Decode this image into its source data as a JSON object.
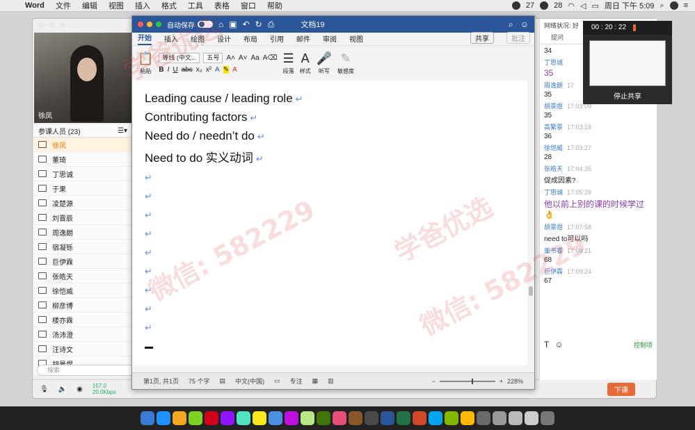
{
  "menubar": {
    "app": "Word",
    "items": [
      "文件",
      "编辑",
      "视图",
      "插入",
      "格式",
      "工具",
      "表格",
      "窗口",
      "帮助"
    ],
    "wechat_count": "27",
    "badge_count": "28",
    "clock": "周日 下午 5:09"
  },
  "classroom": {
    "teacher_name": "徐凤",
    "participants_header": "参课人员 (23)",
    "participants": [
      "徐凤",
      "董琦",
      "丁思诚",
      "于果",
      "凌楚源",
      "刘晋辰",
      "周逸朗",
      "宿凝铄",
      "巨伊霖",
      "张皓天",
      "徐恺威",
      "柳彦博",
      "楼亦霖",
      "汤沛澄",
      "汪诗文",
      "胡景煜"
    ],
    "search_placeholder": "搜索",
    "net_stat": "157.0\n20.0Kbps",
    "end_button": "下课"
  },
  "chat": {
    "network_status": "网络状况: 好",
    "tab_label": "提问",
    "messages": [
      {
        "who": "",
        "time": "",
        "body": "34"
      },
      {
        "who": "丁思诚",
        "time": "",
        "body": "35",
        "accent": true
      },
      {
        "who": "周逸朗",
        "time": "17",
        "body": "35"
      },
      {
        "who": "胡景煜",
        "time": "17:03:09",
        "body": "35"
      },
      {
        "who": "高繁景",
        "time": "17:03:18",
        "body": "36"
      },
      {
        "who": "徐恺威",
        "time": "17:03:27",
        "body": "28"
      },
      {
        "who": "张皓天",
        "time": "17:04:35",
        "body": "促成因素?"
      },
      {
        "who": "丁思诚",
        "time": "17:05:29",
        "body": "他以前上别的课的时候学过👌",
        "accent": true
      },
      {
        "who": "胡景煜",
        "time": "17:07:58",
        "body": "need to可以吗"
      },
      {
        "who": "董书睿",
        "time": "17:09:21",
        "body": "68"
      },
      {
        "who": "巨伊霖",
        "time": "17:09:24",
        "body": "67"
      }
    ],
    "mute_label": "控制项"
  },
  "screen_share": {
    "timer": "00 : 20 : 22",
    "stop_label": "停止共享"
  },
  "word": {
    "autosave": "自动保存",
    "autosave_state": "关闭",
    "doc_title": "文档19",
    "tabs": [
      "开始",
      "插入",
      "绘图",
      "设计",
      "布局",
      "引用",
      "邮件",
      "审阅",
      "视图"
    ],
    "share_label": "共享",
    "comment_label": "批注",
    "ribbon": {
      "paste": "粘贴",
      "font": "等线 (中文...",
      "size": "五号",
      "paragraph": "段落",
      "styles": "样式",
      "dictate": "听写",
      "sensitivity": "敏感度"
    },
    "lines": [
      "Leading cause / leading role",
      "Contributing factors",
      "Need do / needn’t do",
      "Need to do  实义动词"
    ],
    "para_mark": "↵",
    "status": {
      "page": "第1页, 共1页",
      "words": "75 个字",
      "lang": "中文(中国)",
      "focus": "专注",
      "zoom": "228%"
    }
  },
  "watermark": {
    "text1": "学爸优选",
    "text2": "微信: 582229"
  }
}
